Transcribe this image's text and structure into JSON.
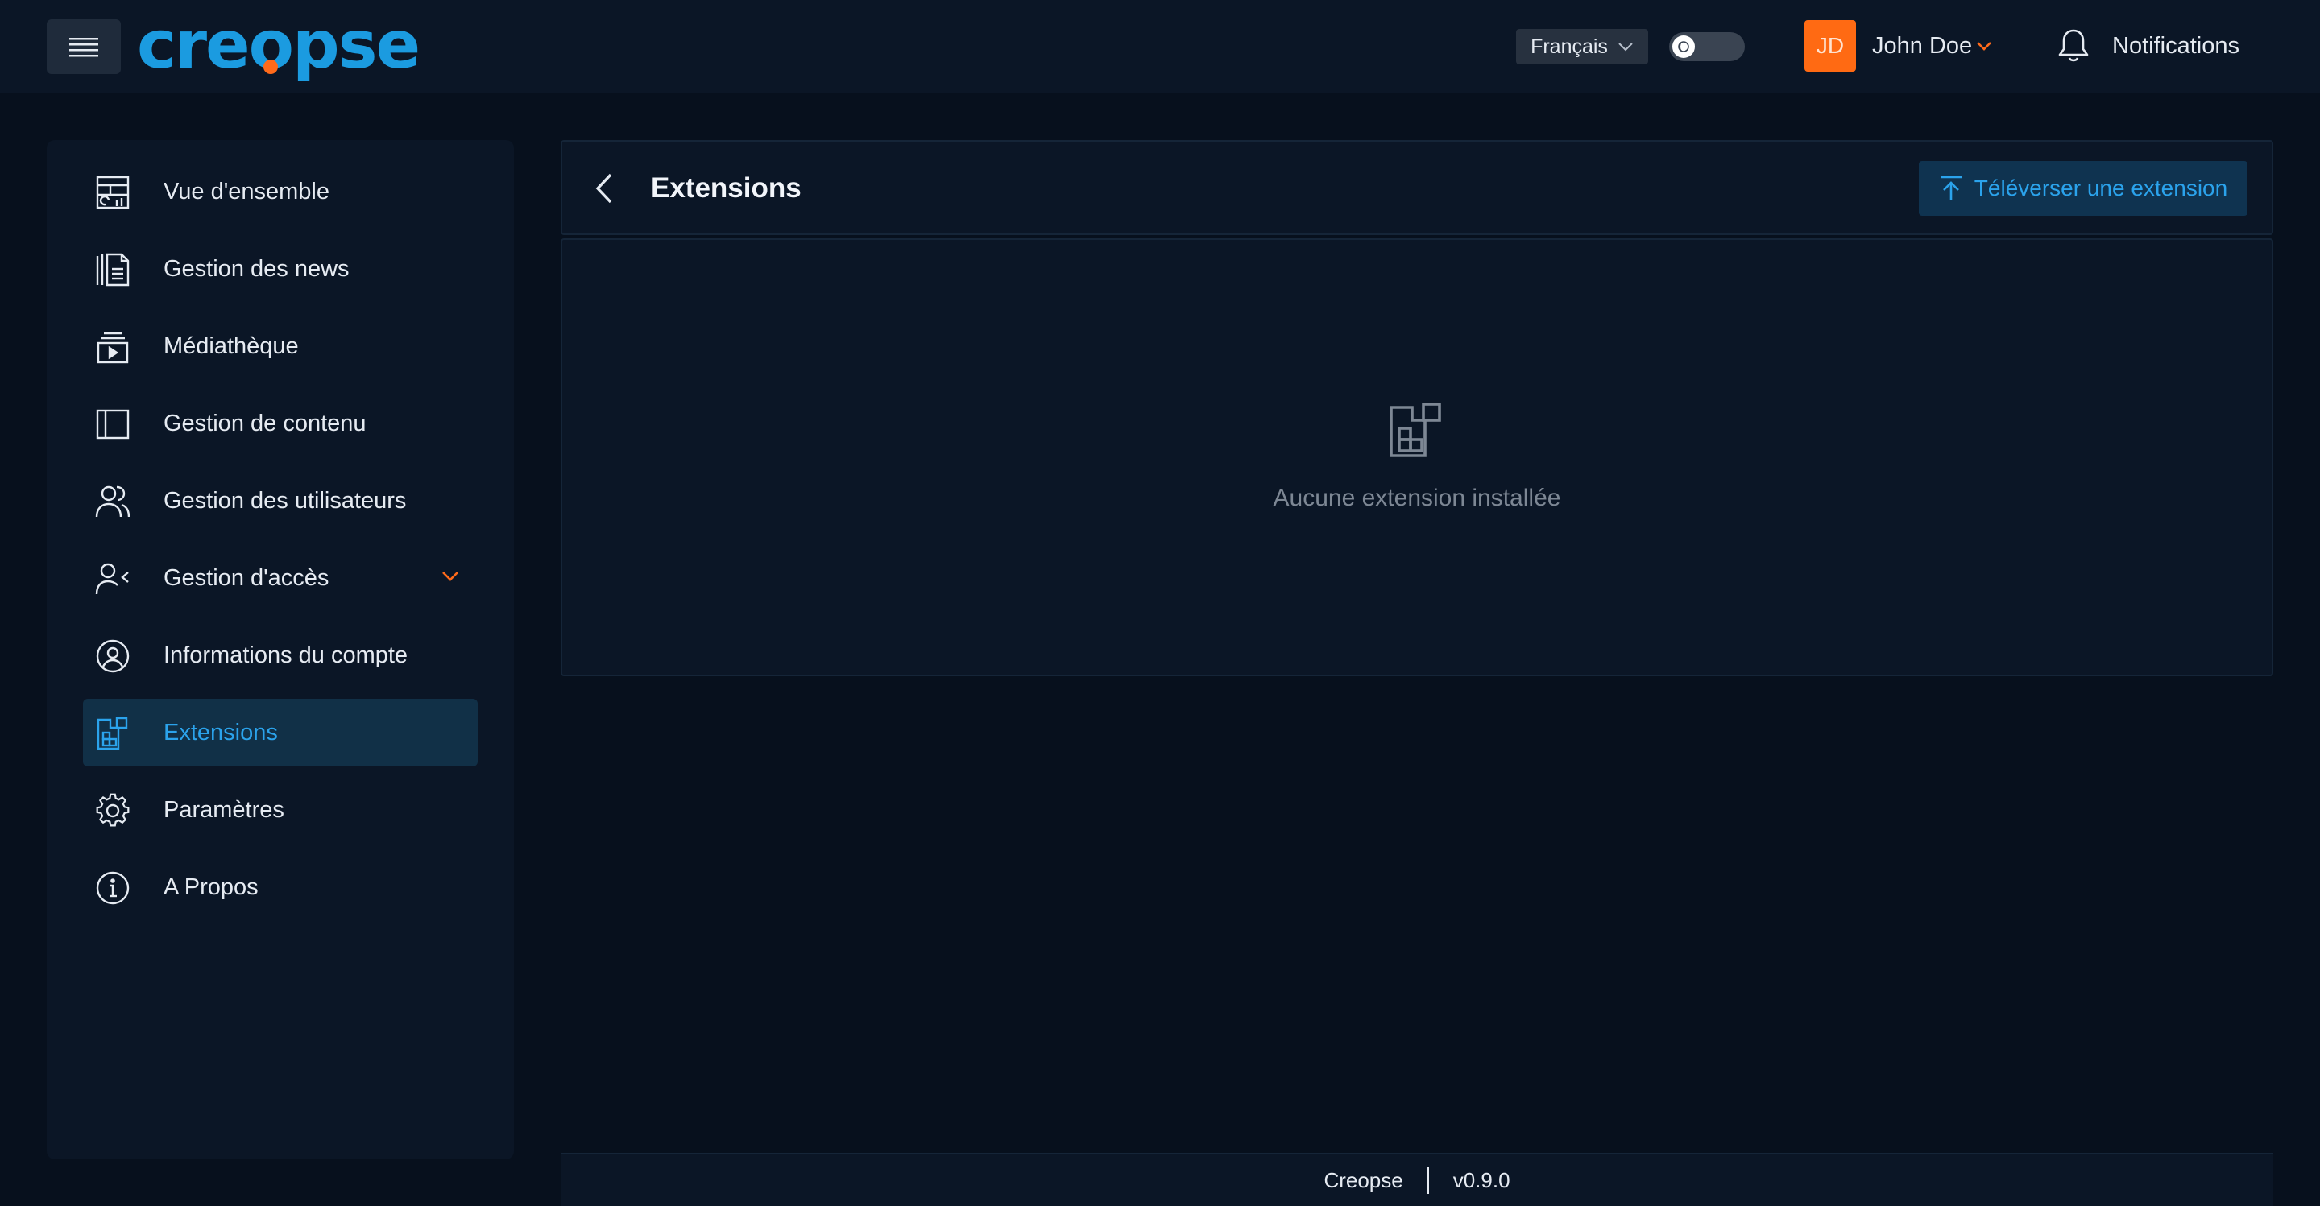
{
  "app": {
    "logo_text": "creopse",
    "brand_color": "#1b9be0",
    "accent_color": "#ff6a1a"
  },
  "topbar": {
    "menu_icon": "hamburger-menu-icon",
    "language": {
      "selected": "Français"
    },
    "theme_toggle": {
      "state": "light",
      "icon": "moon-icon"
    },
    "user": {
      "initials": "JD",
      "name": "John Doe"
    },
    "notifications": {
      "label": "Notifications",
      "icon": "bell-icon"
    }
  },
  "sidebar": {
    "items": [
      {
        "label": "Vue d'ensemble",
        "icon": "dashboard-icon",
        "active": false
      },
      {
        "label": "Gestion des news",
        "icon": "news-icon",
        "active": false
      },
      {
        "label": "Médiathèque",
        "icon": "media-library-icon",
        "active": false
      },
      {
        "label": "Gestion de contenu",
        "icon": "content-layout-icon",
        "active": false
      },
      {
        "label": "Gestion des utilisateurs",
        "icon": "users-icon",
        "active": false
      },
      {
        "label": "Gestion d'accès",
        "icon": "user-access-icon",
        "active": false,
        "expandable": true
      },
      {
        "label": "Informations du compte",
        "icon": "account-circle-icon",
        "active": false
      },
      {
        "label": "Extensions",
        "icon": "extensions-icon",
        "active": true
      },
      {
        "label": "Paramètres",
        "icon": "settings-gear-icon",
        "active": false
      },
      {
        "label": "A Propos",
        "icon": "info-icon",
        "active": false
      }
    ]
  },
  "main": {
    "title": "Extensions",
    "upload_button": "Téléverser une extension",
    "empty_state": "Aucune extension installée"
  },
  "footer": {
    "app_name": "Creopse",
    "version": "v0.9.0"
  }
}
